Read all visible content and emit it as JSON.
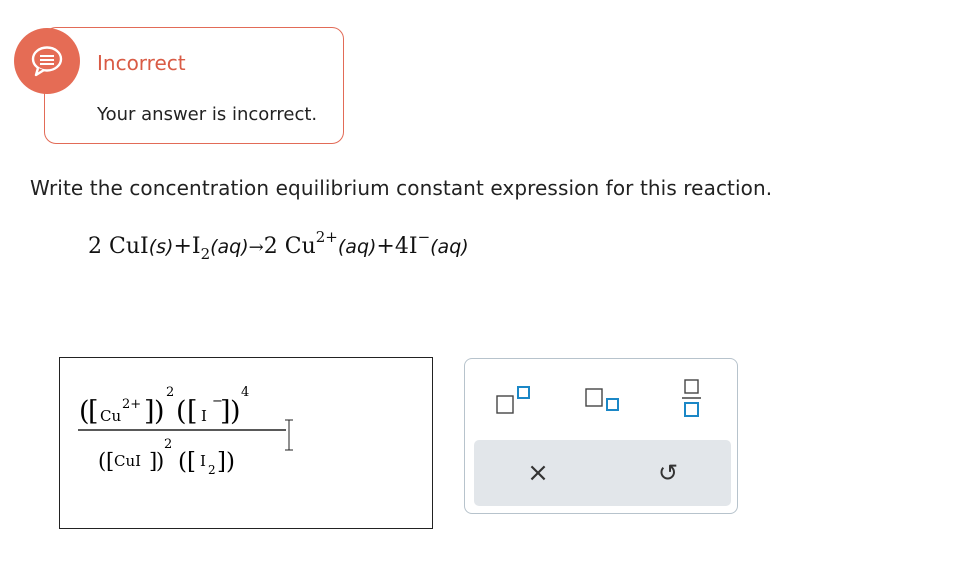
{
  "feedback": {
    "title": "Incorrect",
    "message": "Your answer is incorrect.",
    "accent_color": "#e56c55",
    "icon": "speech-bubble-alert-icon"
  },
  "question": {
    "prompt": "Write the concentration equilibrium constant expression for this reaction."
  },
  "equation": {
    "r1_coef": "2",
    "r1_species": "CuI",
    "r1_phase": "(s)",
    "plus1": "+",
    "r2_species": "I",
    "r2_sub": "2",
    "r2_phase": "(aq)",
    "arrow": "→",
    "p1_coef": "2",
    "p1_species": "Cu",
    "p1_charge": "2+",
    "p1_phase": "(aq)",
    "plus2": "+",
    "p2_coef": "4",
    "p2_species": "I",
    "p2_charge": "−",
    "p2_phase": "(aq)"
  },
  "answer": {
    "num_open_paren": "(",
    "num_close_paren": ")",
    "num_t1_species": "Cu",
    "num_t1_charge": "2+",
    "num_t1_exp": "2",
    "num_t2_species": "I",
    "num_t2_charge": "−",
    "num_t2_exp": "4",
    "den_t1_species": "CuI",
    "den_t1_exp": "2",
    "den_t2_species": "I",
    "den_t2_sub": "2",
    "left_bracket": "[",
    "right_bracket": "]"
  },
  "toolbar": {
    "buttons": [
      {
        "name": "superscript-button",
        "icon": "superscript-icon"
      },
      {
        "name": "subscript-button",
        "icon": "subscript-icon"
      },
      {
        "name": "fraction-button",
        "icon": "fraction-icon"
      },
      {
        "name": "clear-button",
        "icon": "close-icon",
        "glyph": "×"
      },
      {
        "name": "undo-button",
        "icon": "undo-icon",
        "glyph": "↺"
      }
    ],
    "icon_color": "#1b87c6"
  }
}
